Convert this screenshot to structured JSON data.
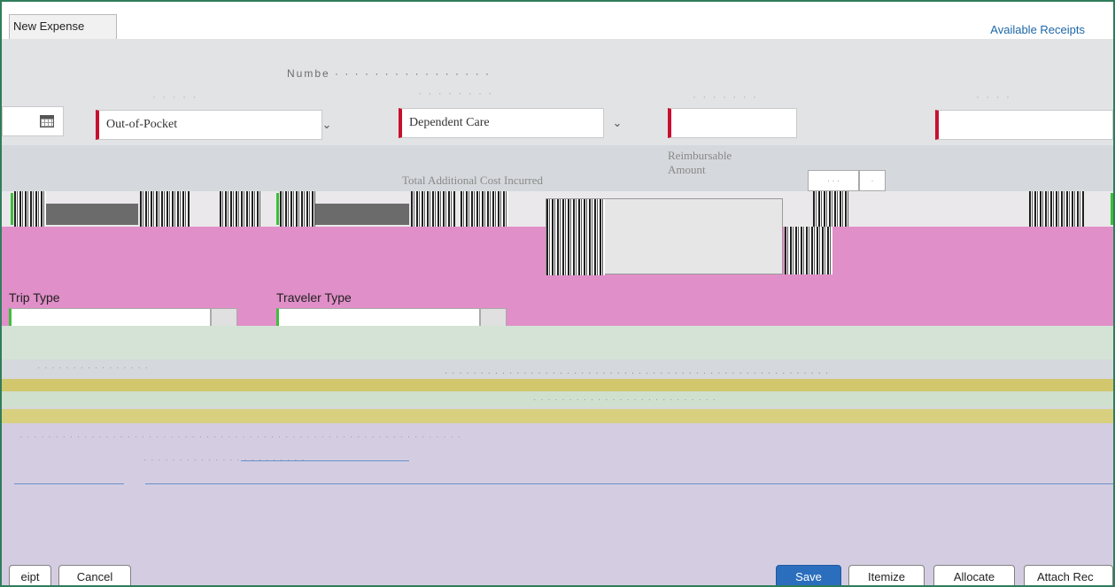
{
  "header": {
    "tab_label": "New Expense",
    "available_receipts_link": "Available Receipts"
  },
  "form": {
    "payment_type_value": "Out-of-Pocket",
    "expense_type_value": "Dependent Care",
    "reimbursable_amount_label": "Reimbursable\nAmount",
    "total_additional_cost_label": "Total Additional Cost Incurred",
    "trip_type_label": "Trip Type",
    "traveler_type_label": "Traveler Type"
  },
  "footer": {
    "buttons": {
      "save_receipt_partial": "eipt",
      "cancel": "Cancel",
      "save": "Save",
      "itemize": "Itemize",
      "allocate": "Allocate",
      "attach_receipt_partial": "Attach Rec"
    }
  },
  "colors": {
    "accent": "#2f7d5b",
    "required": "#c8102e",
    "primary": "#2a6ebd",
    "link": "#1c66a8"
  }
}
